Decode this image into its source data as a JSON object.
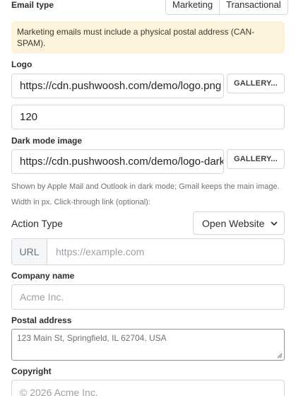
{
  "email_type": {
    "label": "Email type",
    "options": [
      "Marketing",
      "Transactional"
    ]
  },
  "warning": {
    "text": "Marketing emails must include a physical postal address (CAN-SPAM)."
  },
  "logo": {
    "label": "Logo",
    "url_value": "https://cdn.pushwoosh.com/demo/logo.png",
    "gallery_label": "GALLERY...",
    "width_value": "120"
  },
  "dark_mode": {
    "label": "Dark mode image",
    "url_value": "https://cdn.pushwoosh.com/demo/logo-dark.png",
    "gallery_label": "GALLERY...",
    "help_text": "Shown by Apple Mail and Outlook in dark mode; Gmail keeps the main image."
  },
  "width_help": "Width in px. Click-through link (optional):",
  "action_type": {
    "label": "Action Type",
    "selected": "Open Website"
  },
  "url_field": {
    "prefix": "URL",
    "placeholder": "https://example.com"
  },
  "company": {
    "label": "Company name",
    "placeholder": "Acme Inc."
  },
  "postal": {
    "label": "Postal address",
    "placeholder": "123 Main St, Springfield, IL 62704, USA"
  },
  "copyright": {
    "label": "Copyright",
    "placeholder": "© 2026 Acme Inc."
  }
}
